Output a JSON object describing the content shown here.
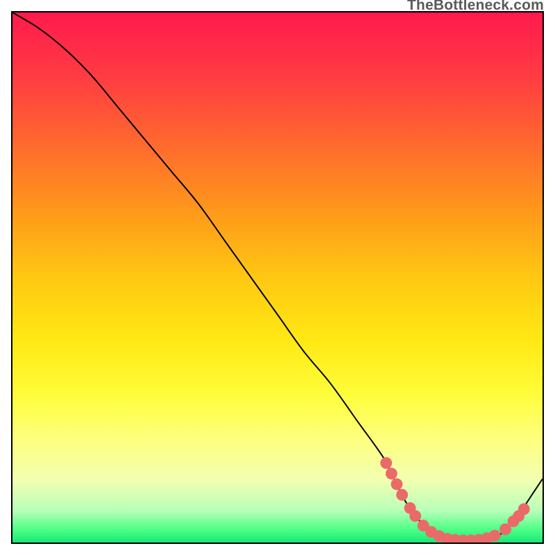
{
  "watermark": "TheBottleneck.com",
  "colors": {
    "marker": "#ea6a6a",
    "curve": "#000000",
    "border": "#000000"
  },
  "chart_data": {
    "type": "line",
    "title": "",
    "xlabel": "",
    "ylabel": "",
    "xlim": [
      0,
      100
    ],
    "ylim": [
      0,
      100
    ],
    "grid": false,
    "legend": false,
    "series": [
      {
        "name": "bottleneck-curve",
        "x": [
          0,
          5,
          10,
          15,
          20,
          25,
          30,
          35,
          40,
          45,
          50,
          55,
          60,
          65,
          70,
          72,
          74,
          76,
          78,
          80,
          82,
          84,
          86,
          88,
          90,
          92,
          94,
          96,
          98,
          100
        ],
        "y": [
          100,
          97,
          93,
          88,
          82,
          76,
          70,
          64,
          57,
          50,
          43,
          36,
          30,
          23,
          16,
          12,
          8,
          5,
          3,
          1.5,
          0.8,
          0.4,
          0.3,
          0.3,
          0.6,
          1.5,
          3.5,
          6,
          9,
          12
        ]
      }
    ],
    "markers": [
      {
        "x": 70.5,
        "y": 15
      },
      {
        "x": 71.5,
        "y": 13
      },
      {
        "x": 72.5,
        "y": 11
      },
      {
        "x": 73.5,
        "y": 9
      },
      {
        "x": 75.0,
        "y": 6.5
      },
      {
        "x": 76.0,
        "y": 5
      },
      {
        "x": 77.5,
        "y": 3.2
      },
      {
        "x": 79.0,
        "y": 2
      },
      {
        "x": 80.5,
        "y": 1.2
      },
      {
        "x": 82.0,
        "y": 0.7
      },
      {
        "x": 83.5,
        "y": 0.5
      },
      {
        "x": 85.0,
        "y": 0.4
      },
      {
        "x": 86.5,
        "y": 0.4
      },
      {
        "x": 88.0,
        "y": 0.5
      },
      {
        "x": 89.5,
        "y": 0.8
      },
      {
        "x": 91.0,
        "y": 1.3
      },
      {
        "x": 93.0,
        "y": 2.5
      },
      {
        "x": 94.5,
        "y": 4
      },
      {
        "x": 95.5,
        "y": 5
      },
      {
        "x": 96.5,
        "y": 6.3
      }
    ]
  }
}
